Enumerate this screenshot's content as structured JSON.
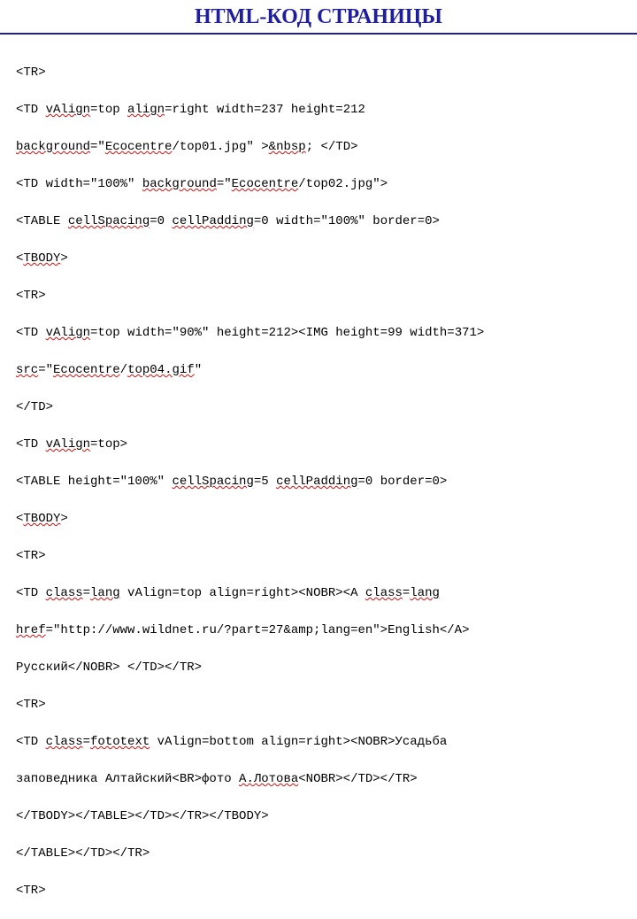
{
  "header": {
    "title": "HTML-КОД СТРАНИЦЫ"
  },
  "code": {
    "l01a": "<TR>",
    "l02a": "  <TD ",
    "l02b": "vAlign",
    "l02c": "=top ",
    "l02d": "align",
    "l02e": "=right width=237 height=212",
    "l03a": "   ",
    "l03b": "background",
    "l03c": "=\"",
    "l03d": "Ecocentre",
    "l03e": "/top01.jpg\" >",
    "l03f": "&nbsp",
    "l03g": "; </TD>",
    "l04a": "  <TD width=\"100%\"  ",
    "l04b": "background",
    "l04c": "=\"",
    "l04d": "Ecocentre",
    "l04e": "/top02.jpg\">",
    "l05a": "    <TABLE ",
    "l05b": "cellSpacing",
    "l05c": "=0 ",
    "l05d": "cellPadding",
    "l05e": "=0 width=\"100%\" border=0>",
    "l06a": "     <",
    "l06b": "TBODY",
    "l06c": ">",
    "l07a": "     <TR>",
    "l08a": "       <TD ",
    "l08b": "vAlign",
    "l08c": "=top width=\"90%\" height=212><IMG height=99 width=371>",
    "l09a": "         ",
    "l09b": "src",
    "l09c": "=\"",
    "l09d": "Ecocentre",
    "l09e": "/",
    "l09f": "top04.gif",
    "l09g": "\"",
    "l10a": "        </TD>",
    "l11a": "       <TD ",
    "l11b": "vAlign",
    "l11c": "=top>",
    "l12a": "        <TABLE height=\"100%\" ",
    "l12b": "cellSpacing",
    "l12c": "=5 ",
    "l12d": "cellPadding",
    "l12e": "=0 border=0>",
    "l13a": "         <",
    "l13b": "TBODY",
    "l13c": ">",
    "l14a": "         <TR>",
    "l15a": "          <TD ",
    "l15b": "class",
    "l15c": "=",
    "l15d": "lang",
    "l15e": " vAlign=top align=right><NOBR><A ",
    "l15f": "class",
    "l15g": "=",
    "l15h": "lang",
    "l16a": "           ",
    "l16b": "href",
    "l16c": "=\"http://www.wildnet.ru/?part=27&amp;lang=en\">English</A>",
    "l17a": "           Русский</NOBR> </TD></TR>",
    "l18a": "         <TR>",
    "l19a": "          <TD ",
    "l19b": "class",
    "l19c": "=",
    "l19d": "fototext",
    "l19e": " vAlign=bottom align=right><NOBR>Усадьба",
    "l20a": "           заповедника Алтайский<BR>фото ",
    "l20b": "А.Лотова",
    "l20c": "<NOBR></TD></TR>",
    "l21a": "          </TBODY></TABLE></TD></TR></TBODY>",
    "l22a": "       </TABLE></TD></TR>",
    "l23a": "<TR>"
  }
}
